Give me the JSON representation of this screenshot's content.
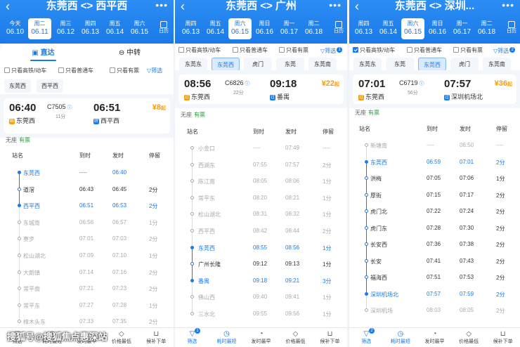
{
  "header_icons": {
    "back": "back-arrow-icon",
    "more": "more-dots-icon",
    "calendar": "calendar-icon"
  },
  "panels": [
    {
      "title": "东莞西 <> 西平西",
      "calendar_label": "日历",
      "dates": [
        {
          "wd": "今天",
          "dt": "06.10"
        },
        {
          "wd": "周二",
          "dt": "06.11",
          "sel": true
        },
        {
          "wd": "周三",
          "dt": "06.12"
        },
        {
          "wd": "周四",
          "dt": "06.13"
        },
        {
          "wd": "周五",
          "dt": "06.14"
        },
        {
          "wd": "周六",
          "dt": "06.15"
        }
      ],
      "tabs": [
        "直达",
        "中转"
      ],
      "filters": [
        {
          "label": "只看高铁/动车",
          "on": false
        },
        {
          "label": "只看普通车",
          "on": false
        },
        {
          "label": "只看有票",
          "on": false
        }
      ],
      "filter_btn": "筛选",
      "chips": [
        "东莞西",
        "西平西"
      ],
      "train": {
        "dep_time": "06:40",
        "number": "C7505",
        "arr_time": "06:51",
        "duration": "11分",
        "dep_station": "东莞西",
        "arr_station": "西平西",
        "price": "¥8",
        "price_suffix": "起",
        "seat": "无座",
        "seat_status": "有票",
        "start_tag": "始",
        "end_tag": "终"
      },
      "table_headers": [
        "站名",
        "到时",
        "发时",
        "停留"
      ],
      "stops": [
        {
          "name": "东莞西",
          "arr": "----",
          "dep": "06:40",
          "stay": "",
          "type": "key"
        },
        {
          "name": "道滘",
          "arr": "06:43",
          "dep": "06:45",
          "stay": "2分",
          "type": "mid"
        },
        {
          "name": "西平西",
          "arr": "06:51",
          "dep": "06:53",
          "stay": "2分",
          "type": "key"
        },
        {
          "name": "东城南",
          "arr": "06:56",
          "dep": "06:57",
          "stay": "1分",
          "type": "grey"
        },
        {
          "name": "寮步",
          "arr": "07:01",
          "dep": "07:03",
          "stay": "2分",
          "type": "grey"
        },
        {
          "name": "松山湖北",
          "arr": "07:09",
          "dep": "07:10",
          "stay": "1分",
          "type": "grey"
        },
        {
          "name": "大朗镇",
          "arr": "07:14",
          "dep": "07:16",
          "stay": "2分",
          "type": "grey"
        },
        {
          "name": "常平南",
          "arr": "07:21",
          "dep": "07:23",
          "stay": "2分",
          "type": "grey"
        },
        {
          "name": "常平东",
          "arr": "07:27",
          "dep": "07:28",
          "stay": "1分",
          "type": "grey"
        },
        {
          "name": "樟木头东",
          "arr": "07:33",
          "dep": "07:35",
          "stay": "2分",
          "type": "grey"
        }
      ],
      "bottom": []
    },
    {
      "title": "东莞西 <> 广州",
      "calendar_label": "日历",
      "dates": [
        {
          "wd": "周四",
          "dt": "06.13"
        },
        {
          "wd": "周五",
          "dt": "06.14"
        },
        {
          "wd": "周六",
          "dt": "06.15",
          "sel": true
        },
        {
          "wd": "周日",
          "dt": "06.16"
        },
        {
          "wd": "周一",
          "dt": "06.17"
        },
        {
          "wd": "周二",
          "dt": "06.18"
        }
      ],
      "filters": [
        {
          "label": "只看高铁/动车",
          "on": false
        },
        {
          "label": "只看普通车",
          "on": false
        },
        {
          "label": "只看有票",
          "on": false
        }
      ],
      "filter_btn": "筛选",
      "filter_badge": "1",
      "chips": [
        "东莞东",
        "东莞西",
        "虎门",
        "东莞",
        "东莞南"
      ],
      "chip_sel": 1,
      "train": {
        "dep_time": "08:56",
        "number": "C6826",
        "arr_time": "09:18",
        "duration": "22分",
        "dep_station": "东莞西",
        "arr_station": "番禺",
        "price": "¥22",
        "price_suffix": "起",
        "seat": "无座",
        "seat_status": "有票",
        "start_tag": "过",
        "end_tag": "过"
      },
      "table_headers": [
        "站名",
        "到时",
        "发时",
        "停留"
      ],
      "stops": [
        {
          "name": "小金口",
          "arr": "----",
          "dep": "07:49",
          "stay": "----",
          "type": "grey"
        },
        {
          "name": "西湖东",
          "arr": "07:55",
          "dep": "07:57",
          "stay": "2分",
          "type": "grey"
        },
        {
          "name": "陈江南",
          "arr": "08:05",
          "dep": "08:06",
          "stay": "1分",
          "type": "grey"
        },
        {
          "name": "常平东",
          "arr": "08:20",
          "dep": "08:21",
          "stay": "1分",
          "type": "grey"
        },
        {
          "name": "松山湖北",
          "arr": "08:31",
          "dep": "08:32",
          "stay": "1分",
          "type": "grey"
        },
        {
          "name": "西平西",
          "arr": "08:42",
          "dep": "08:44",
          "stay": "2分",
          "type": "grey"
        },
        {
          "name": "东莞西",
          "arr": "08:55",
          "dep": "08:56",
          "stay": "1分",
          "type": "key"
        },
        {
          "name": "广州长隆",
          "arr": "09:12",
          "dep": "09:13",
          "stay": "1分",
          "type": "mid"
        },
        {
          "name": "番禺",
          "arr": "09:18",
          "dep": "09:21",
          "stay": "3分",
          "type": "key"
        },
        {
          "name": "佛山西",
          "arr": "09:40",
          "dep": "09:41",
          "stay": "1分",
          "type": "grey"
        },
        {
          "name": "三水北",
          "arr": "09:55",
          "dep": "09:56",
          "stay": "1分",
          "type": "grey"
        }
      ],
      "bottom": [
        {
          "label": "筛选",
          "icon": "filter-icon",
          "glyph": "▽",
          "act": true,
          "badge": "1"
        },
        {
          "label": "耗时最短",
          "icon": "clock-icon",
          "glyph": "◷",
          "act": true
        },
        {
          "label": "发时最早",
          "icon": "departure-icon",
          "glyph": "◔"
        },
        {
          "label": "价格最低",
          "icon": "price-tag-icon",
          "glyph": "◇"
        },
        {
          "label": "候补下单",
          "icon": "cart-icon",
          "glyph": "⊔"
        }
      ]
    },
    {
      "title": "东莞西 <> 深圳...",
      "calendar_label": "日历",
      "dates": [
        {
          "wd": "周四",
          "dt": "06.13"
        },
        {
          "wd": "周五",
          "dt": "06.14"
        },
        {
          "wd": "周六",
          "dt": "06.15",
          "sel": true
        },
        {
          "wd": "周日",
          "dt": "06.16"
        },
        {
          "wd": "周一",
          "dt": "06.17"
        },
        {
          "wd": "周二",
          "dt": "06.18"
        }
      ],
      "filters": [
        {
          "label": "只看高铁/动车",
          "on": true
        },
        {
          "label": "只看普通车",
          "on": false
        },
        {
          "label": "只看有票",
          "on": false
        }
      ],
      "filter_btn": "筛选",
      "filter_badge": "2",
      "chips": [
        "东莞东",
        "东莞",
        "东莞西",
        "虎门",
        "东莞南"
      ],
      "chip_sel": 2,
      "train": {
        "dep_time": "07:01",
        "number": "C6719",
        "arr_time": "07:57",
        "duration": "56分",
        "dep_station": "东莞西",
        "arr_station": "深圳机场北",
        "price": "¥36",
        "price_suffix": "起",
        "seat": "无座",
        "seat_status": "有票",
        "start_tag": "过",
        "end_tag": "过"
      },
      "table_headers": [
        "站名",
        "到时",
        "发时",
        "停留"
      ],
      "stops": [
        {
          "name": "新塘南",
          "arr": "----",
          "dep": "06:50",
          "stay": "----",
          "type": "grey"
        },
        {
          "name": "东莞西",
          "arr": "06:59",
          "dep": "07:01",
          "stay": "2分",
          "type": "key"
        },
        {
          "name": "洪梅",
          "arr": "07:05",
          "dep": "07:06",
          "stay": "1分",
          "type": "mid"
        },
        {
          "name": "厚街",
          "arr": "07:15",
          "dep": "07:17",
          "stay": "2分",
          "type": "mid"
        },
        {
          "name": "虎门北",
          "arr": "07:22",
          "dep": "07:24",
          "stay": "2分",
          "type": "mid"
        },
        {
          "name": "虎门东",
          "arr": "07:28",
          "dep": "07:30",
          "stay": "2分",
          "type": "mid"
        },
        {
          "name": "长安西",
          "arr": "07:36",
          "dep": "07:38",
          "stay": "2分",
          "type": "mid"
        },
        {
          "name": "长安",
          "arr": "07:41",
          "dep": "07:43",
          "stay": "2分",
          "type": "mid"
        },
        {
          "name": "福海西",
          "arr": "07:51",
          "dep": "07:53",
          "stay": "2分",
          "type": "mid"
        },
        {
          "name": "深圳机场北",
          "arr": "07:57",
          "dep": "07:59",
          "stay": "2分",
          "type": "key"
        },
        {
          "name": "深圳机场",
          "arr": "08:03",
          "dep": "08:05",
          "stay": "2分",
          "type": "grey"
        }
      ],
      "bottom": [
        {
          "label": "筛选",
          "icon": "filter-icon",
          "glyph": "▽",
          "act": true,
          "badge": "2"
        },
        {
          "label": "耗时最短",
          "icon": "clock-icon",
          "glyph": "◷",
          "act": true
        },
        {
          "label": "发时最早",
          "icon": "departure-icon",
          "glyph": "◔"
        },
        {
          "label": "价格最低",
          "icon": "price-tag-icon",
          "glyph": "◇"
        },
        {
          "label": "候补下单",
          "icon": "cart-icon",
          "glyph": "⊔"
        }
      ]
    }
  ],
  "panel1_bottom": [
    {
      "label": "筛选",
      "icon": "filter-icon",
      "glyph": "▽"
    },
    {
      "label": "耗时最短",
      "icon": "clock-icon",
      "glyph": "◷"
    },
    {
      "label": "发时最早",
      "icon": "departure-icon",
      "glyph": "◔"
    },
    {
      "label": "价格最低",
      "icon": "price-tag-icon",
      "glyph": "◇"
    },
    {
      "label": "候补下单",
      "icon": "cart-icon",
      "glyph": "⊔"
    }
  ],
  "watermark": "搜狐号@搜狐焦点惠深站",
  "colors": {
    "accent": "#1a7ae8",
    "price": "#f39c12",
    "available": "#2ea043",
    "muted": "#aaaaaa"
  }
}
